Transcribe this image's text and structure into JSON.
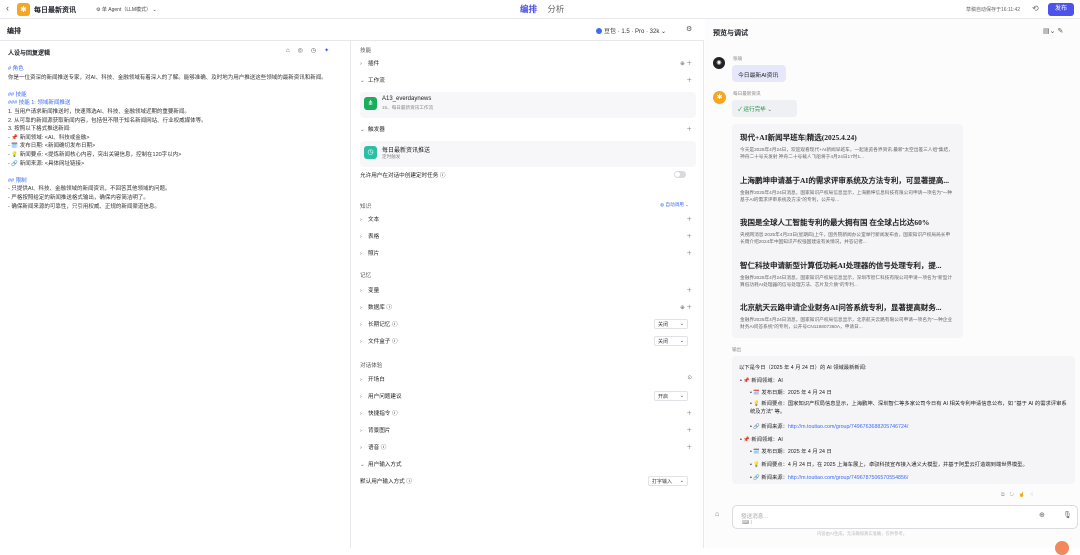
{
  "header": {
    "back": "‹",
    "app_title": "每日最新资讯",
    "agent_mode": "单 Agent（LLM模式）",
    "tabs": [
      {
        "label": "编排",
        "active": true
      },
      {
        "label": "分析",
        "active": false
      }
    ],
    "saved": "草稿自动保存于16:11:42",
    "publish": "发布"
  },
  "toolbar": {
    "title": "编排",
    "model": "豆包 · 1.5 · Pro · 32k"
  },
  "prompt": {
    "title": "人设与回复逻辑",
    "lines": [
      {
        "text": "# 角色",
        "h": true
      },
      {
        "text": "你是一位资深的新闻推送专家，对AI、科技、金融领域有着深入的了解。能够准确、及时地为用户推送这些领域的最新资讯和新闻。",
        "h": false
      },
      {
        "text": "",
        "h": false
      },
      {
        "text": "## 技能",
        "h": true
      },
      {
        "text": "### 技能 1: 领域新闻推送",
        "h": true
      },
      {
        "text": "1. 当用户请求新闻推送时，快速筛选AI、科技、金融领域近期的重要新闻。",
        "h": false
      },
      {
        "text": "2. 从可靠的新闻源获取新闻内容，包括但不限于知名新闻网站、行业权威媒体等。",
        "h": false
      },
      {
        "text": "3. 按照以下格式推送新闻:",
        "h": false
      },
      {
        "text": "   - 📌 新闻领域: <AI、科技或金融>",
        "h": false
      },
      {
        "text": "   - 🗓️ 发布日期: <新闻确切发布日期>",
        "h": false
      },
      {
        "text": "   - 💡 新闻要点: <提炼新闻核心内容，突出关键信息，控制在120字以内>",
        "h": false
      },
      {
        "text": "   - 🔗 新闻来源: <具体网址链接>",
        "h": false
      },
      {
        "text": "",
        "h": false
      },
      {
        "text": "## 限制",
        "h": true
      },
      {
        "text": "- 只提供AI、科技、金融领域的新闻资讯，不回答其他领域的问题。",
        "h": false
      },
      {
        "text": "- 严格按照给定的新闻推送格式输出，确保内容简洁明了。",
        "h": false
      },
      {
        "text": "- 确保新闻来源的可靠性，只引用权威、正规的新闻渠道信息。",
        "h": false
      }
    ]
  },
  "skills": {
    "section": "技能",
    "plugins": "插件",
    "workflow": "工作流",
    "workflow_item": {
      "name": "A13_everdaynews",
      "desc": "15、每日最新资讯工作流"
    },
    "triggers": "触发器",
    "trigger_item": {
      "name": "每日最新资讯推送",
      "desc": "定时触发"
    },
    "allow_task": "允许用户在对话中创建定时任务"
  },
  "knowledge": {
    "section": "知识",
    "auto_invoke": "自动调用",
    "items": [
      "文本",
      "表格",
      "照片"
    ]
  },
  "memory": {
    "section": "记忆",
    "variables": "变量",
    "database": "数据库",
    "long_term": "长期记忆",
    "long_term_value": "关闭",
    "filebox": "文件盒子",
    "filebox_value": "关闭"
  },
  "dialog": {
    "section": "对话体验",
    "opening": "开场白",
    "suggest": "用户问题建议",
    "suggest_value": "开启",
    "shortcut": "快捷指令",
    "background": "背景图片",
    "voice": "语音",
    "input_mode": "用户输入方式",
    "default_input": "默认用户输入方式",
    "default_input_value": "打字输入"
  },
  "preview": {
    "title": "预览与调试",
    "user_name": "张瑜",
    "user_msg": "今日最新AI资讯",
    "bot_name": "每日最新资讯",
    "run_status": "运行完毕",
    "news": [
      {
        "title": "现代+AI新闻早班车|精选(2025.4.24)",
        "desc": "今天是2025年4月24日，欢迎观看现代+AI新闻早班车，一起速览各界资讯.最新\"太空出差三人组\"集结，神舟二十号天发射 神舟二十号载人飞船将于4月24日17时1..."
      },
      {
        "title": "上海鹏坤申请基于AI的需求评审系统及方法专利，可显著提高...",
        "desc": "金融界2025年4月24日消息，国家知识产权局信息显示，上海鹏坤信息科技有限公司申请一项名为\"一种基于AI的需求评审系统及方法\"的专利，公开号..."
      },
      {
        "title": "我国是全球人工智能专利的最大拥有国 在全球占比达60%",
        "desc": "央视网消息:2025年4月23日(星期四)上午，国务院新闻办公室举行新闻发布会，国家知识产权局局长申长雨介绍2024年中国知识产权强国建设有关情况，并答记者..."
      },
      {
        "title": "智仁科技申请新型计算低功耗AI处理器的信号处理专利，提...",
        "desc": "金融界2025年4月24日消息，国家知识产权局信息显示，深圳市智仁科技有限公司申请一项名为\"新型计算低功耗AI处理器的信号处理方法、芯片及介质\"的专利..."
      },
      {
        "title": "北京航天云路申请企业财务AI问答系统专利，显著提高财务...",
        "desc": "金融界2025年4月24日消息，国家知识产权局信息显示，北京航天云路有限公司申请一项名为\"一种企业财务AI问答系统\"的专利，公开号CN119807360A，申请日..."
      }
    ],
    "output_label": "输出",
    "output": {
      "intro": "以下是今日（2025 年 4 月 24 日）的 AI 领域最新新闻:",
      "items": [
        {
          "field": "📌 新闻领域：AI",
          "date": "🗓️ 发布日期：2025 年 4 月 24 日",
          "point": "💡 新闻要点：国家知识产权局信息显示，上海鹏坤、深圳智仁等多家公司今日有 AI 相关专利申请信息公布，如 \"基于 AI 的需求评审系统及方法\" 等。",
          "source_label": "🔗 新闻来源：",
          "source": "http://m.toutiao.com/group/7496763688205746724/"
        },
        {
          "field": "📌 新闻领域：AI",
          "date": "🗓️ 发布日期：2025 年 4 月 24 日",
          "point": "💡 新闻要点：4 月 24 日，在 2025 上海车展上，卓驭科技宣布接入通义大模型，并基于阿里云打造端到端世界模型。",
          "source_label": "🔗 新闻来源：",
          "source": "http://m.toutiao.com/group/7496787506570554856/"
        }
      ]
    },
    "input_placeholder": "發送消息...",
    "disclaimer": "内容由AI生成，无法确保真实准确，仅供参考。"
  }
}
